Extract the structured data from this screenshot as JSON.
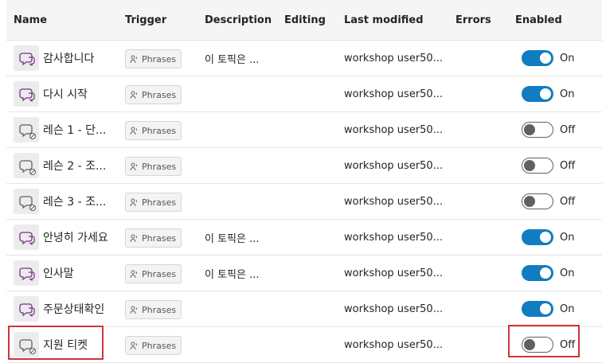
{
  "columns": {
    "name": "Name",
    "trigger": "Trigger",
    "description": "Description",
    "editing": "Editing",
    "last_modified": "Last modified",
    "errors": "Errors",
    "enabled": "Enabled"
  },
  "toggle_labels": {
    "on": "On",
    "off": "Off"
  },
  "colors": {
    "accent": "#117cbf",
    "highlight": "#d13438",
    "topic_icon": "#7a2f86"
  },
  "rows": [
    {
      "name": "감사합니다",
      "trigger": "Phrases",
      "description": "이 토픽은 ...",
      "last_modified": "workshop user50...",
      "enabled": true,
      "enabled_label": "On",
      "icon": "chat-topic-icon"
    },
    {
      "name": "다시 시작",
      "trigger": "Phrases",
      "description": "",
      "last_modified": "workshop user50...",
      "enabled": true,
      "enabled_label": "On",
      "icon": "chat-topic-icon"
    },
    {
      "name": "레슨 1 - 단...",
      "trigger": "Phrases",
      "description": "",
      "last_modified": "workshop user50...",
      "enabled": false,
      "enabled_label": "Off",
      "icon": "chat-topic-disabled-icon"
    },
    {
      "name": "레슨 2 - 조...",
      "trigger": "Phrases",
      "description": "",
      "last_modified": "workshop user50...",
      "enabled": false,
      "enabled_label": "Off",
      "icon": "chat-topic-disabled-icon"
    },
    {
      "name": "레슨 3 - 조...",
      "trigger": "Phrases",
      "description": "",
      "last_modified": "workshop user50...",
      "enabled": false,
      "enabled_label": "Off",
      "icon": "chat-topic-disabled-icon"
    },
    {
      "name": "안녕히 가세요",
      "trigger": "Phrases",
      "description": "이 토픽은 ...",
      "last_modified": "workshop user50...",
      "enabled": true,
      "enabled_label": "On",
      "icon": "chat-topic-icon"
    },
    {
      "name": "인사말",
      "trigger": "Phrases",
      "description": "이 토픽은 ...",
      "last_modified": "workshop user50...",
      "enabled": true,
      "enabled_label": "On",
      "icon": "chat-topic-icon"
    },
    {
      "name": "주문상태확인",
      "trigger": "Phrases",
      "description": "",
      "last_modified": "workshop user50...",
      "enabled": true,
      "enabled_label": "On",
      "icon": "chat-topic-icon"
    },
    {
      "name": "지원 티켓",
      "trigger": "Phrases",
      "description": "",
      "last_modified": "workshop user50...",
      "enabled": false,
      "enabled_label": "Off",
      "icon": "chat-topic-disabled-icon",
      "highlighted": true
    }
  ]
}
